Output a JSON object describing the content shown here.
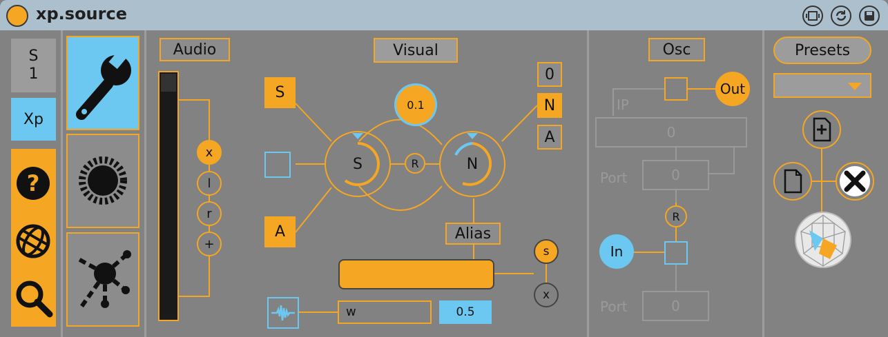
{
  "window": {
    "title": "xp.source"
  },
  "left": {
    "s_label": "S\n1",
    "xp_label": "Xp"
  },
  "audio": {
    "title": "Audio",
    "buttons": [
      "x",
      "l",
      "r",
      "+"
    ]
  },
  "visual": {
    "title": "Visual",
    "s_label": "S",
    "a_label": "A",
    "value": "0.1",
    "r_label": "R",
    "knob_s": "S",
    "knob_n": "N",
    "mode_0": "0",
    "mode_n": "N",
    "mode_a": "A",
    "alias_label": "Alias",
    "s_small": "s",
    "x_small": "x",
    "w_field": "w",
    "w_value": "0.5"
  },
  "osc": {
    "title": "Osc",
    "out": "Out",
    "ip": "IP",
    "ip_value": "0",
    "port1": "Port",
    "port1_value": "0",
    "r": "R",
    "in": "In",
    "port2": "Port",
    "port2_value": "0"
  },
  "presets": {
    "title": "Presets"
  },
  "colors": {
    "accent": "#f5a623",
    "blue": "#6cc8f0",
    "panel": "#828282"
  }
}
